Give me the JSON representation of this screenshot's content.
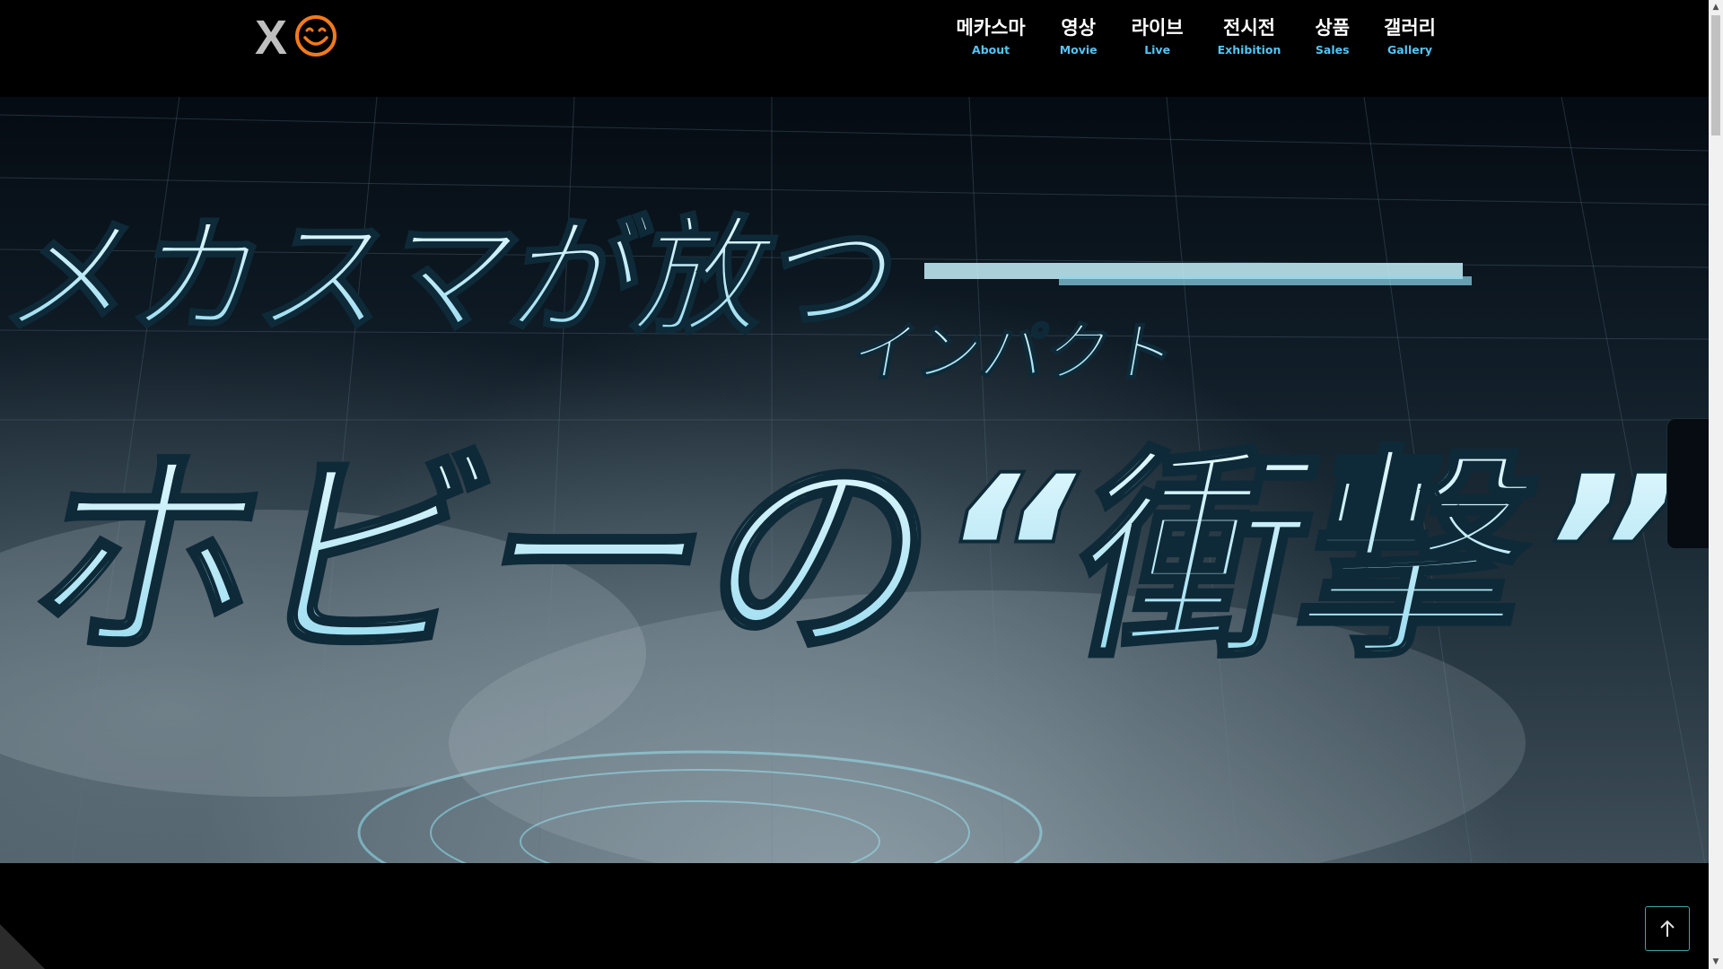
{
  "brand": {
    "logo_letter": "X",
    "logo_icon": "smiley-face-icon",
    "logo_color": "#f07a1e"
  },
  "nav": {
    "items": [
      {
        "ko": "메카스마",
        "en": "About"
      },
      {
        "ko": "영상",
        "en": "Movie"
      },
      {
        "ko": "라이브",
        "en": "Live"
      },
      {
        "ko": "전시전",
        "en": "Exhibition"
      },
      {
        "ko": "상품",
        "en": "Sales"
      },
      {
        "ko": "갤러리",
        "en": "Gallery"
      }
    ],
    "accent_color": "#55c4f4"
  },
  "hero": {
    "line1": "メカスマが放つ",
    "ruby": "インパクト",
    "line2": "ホビーの“衝撃”"
  },
  "controls": {
    "to_top_icon": "arrow-up-icon",
    "side_tab_icon": "side-panel-tab"
  },
  "scrollbar": {
    "up_arrow": "▲",
    "down_arrow": "▼"
  }
}
